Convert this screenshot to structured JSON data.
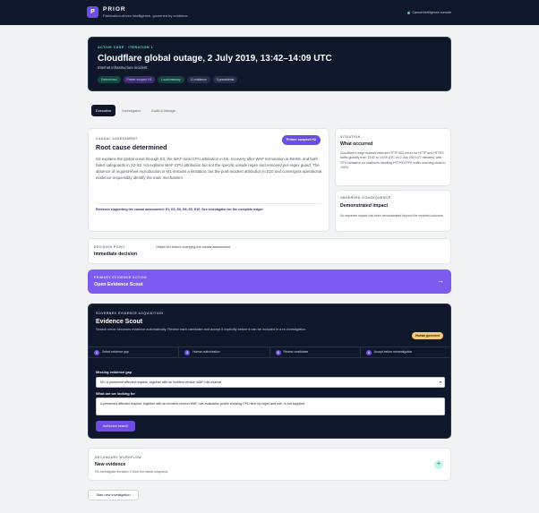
{
  "app": {
    "logo_letter": "P",
    "brand": "PRIOR",
    "tagline": "Fabrication-driven intelligence, governed by evidence.",
    "console": "Causal intelligence console",
    "console_status_color": "#34d399",
    "accent": "#6d4de6"
  },
  "case": {
    "kicker": "ACTIVE CASE · ITERATION 1",
    "title": "Cloudflare global outage, 2 July 2019, 13:42–14:09 UTC",
    "subtitle": "Internet infrastructure incident",
    "chips": [
      "Determined",
      "Primer suspect H2",
      "Local memory",
      "11 evidence",
      "0 precedents"
    ]
  },
  "tabs": [
    {
      "label": "Executive",
      "active": true
    },
    {
      "label": "Investigator",
      "active": false
    },
    {
      "label": "Audit & lineage",
      "active": false
    }
  ],
  "assessment": {
    "eyebrow": "CAUSAL ASSESSMENT",
    "title": "Root cause determined",
    "badge": "Primer suspect H2",
    "body": "H2 explains the global onset through E3, the WAF-local CPU attribution in E6, recovery after WAF termination in E8-E9, and both failed safeguards in X2-X3. H4 explains WAF CPU attribution but not the specific unsafe regex and removed per-regex guard. The absence of request-level reproduction in M1 remains a limitation, but the post-incident attribution in E10 and convergent operational evidence responsibly identify the main mechanism.",
    "evidence_note": "Evidence supporting the causal assessment: E1, E3, E6, E8, E9, E10. See Investigator for the complete ledger."
  },
  "situation": {
    "eyebrow": "SITUATION",
    "title": "What occurred",
    "body": "Cloudflare's edge network returned HTTP 502 errors for HTTP and HTTPS traffic globally from 13:42 to 14:09 UTC on 2 July 2019 (27 minutes), with CPU utilization on machines handling HTTP/HTTPS traffic reaching close to 100%."
  },
  "impact": {
    "eyebrow": "OBSERVED CONSEQUENCE",
    "title": "Demonstrated impact",
    "body": "No separate impact has been demonstrated beyond the reported outcome."
  },
  "decision": {
    "eyebrow": "DECISION POINT",
    "title": "Immediate decision",
    "note": "Obtain M1 before changing the causal assessment."
  },
  "primary_action": {
    "eyebrow": "PRIMARY EVIDENCE ACTION",
    "title": "Open Evidence Scout",
    "arrow": "→"
  },
  "scout": {
    "eyebrow": "GOVERNED EVIDENCE ACQUISITION",
    "title": "Evidence Scout",
    "desc": "Search never becomes evidence automatically. Review each candidate and accept it explicitly before it can be included in a re-investigation.",
    "governed": "Human governed",
    "steps": [
      {
        "num": "1",
        "label": "Select evidence gap"
      },
      {
        "num": "2",
        "label": "Human authorization"
      },
      {
        "num": "3",
        "label": "Review candidates"
      },
      {
        "num": "4",
        "label": "Accept before reinvestigation"
      }
    ],
    "gap_label": "Missing evidence gap",
    "gap_value": "M1: A preserved affected request, together with an incident-version WAF rule-evaluat",
    "look_label": "What are we looking for",
    "look_value": "A preserved affected request, together with an incident-version WAF rule-evaluation profile showing CPU time by regex and rule, is not supplied.",
    "auth_button": "Authorize search"
  },
  "secondary": {
    "eyebrow": "SECONDARY WORKFLOW",
    "title": "New evidence",
    "note": "Re-investigate iteration 2 from the latest snapshot.",
    "plus": "+"
  },
  "start_button": "Start new investigation"
}
